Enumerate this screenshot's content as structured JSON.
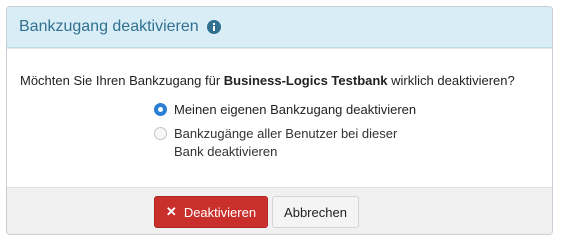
{
  "dialog": {
    "title": "Bankzugang deaktivieren",
    "info_icon": "info-icon",
    "question_prefix": "Möchten Sie Ihren Bankzugang für ",
    "bank_name": "Business-Logics Testbank",
    "question_suffix": " wirklich deaktivieren?",
    "options": [
      {
        "label": "Meinen eigenen Bankzugang deaktivieren",
        "checked": true
      },
      {
        "label_line1": "Bankzugänge aller Benutzer bei dieser",
        "label_line2": "Bank deaktivieren",
        "checked": false
      }
    ],
    "buttons": {
      "confirm_icon": "close-icon",
      "confirm": "Deaktivieren",
      "cancel": "Abbrechen"
    },
    "colors": {
      "header_bg": "#d9edf7",
      "header_text": "#31708f",
      "danger": "#c9302c",
      "radio_accent": "#2a7fd4"
    }
  }
}
